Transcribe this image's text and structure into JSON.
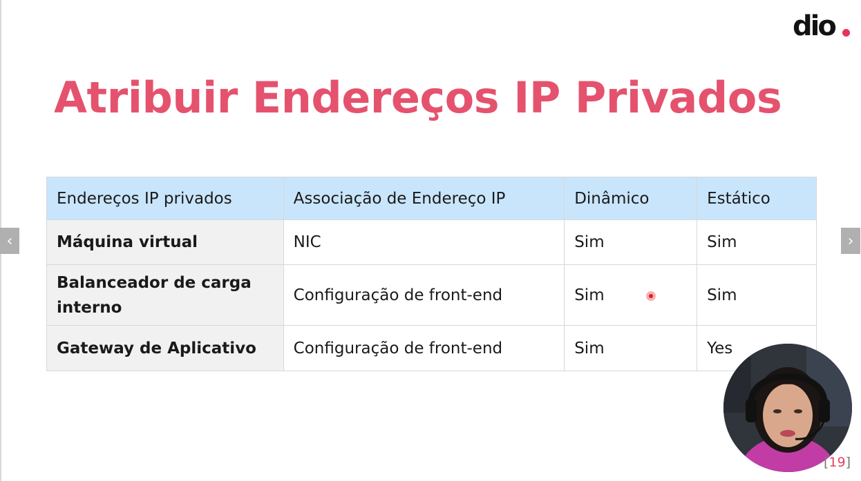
{
  "slide": {
    "logo_text": "dio",
    "title": "Atribuir Endereços IP Privados",
    "table": {
      "headers": [
        "Endereços IP privados",
        "Associação de Endereço IP",
        "Dinâmico",
        "Estático"
      ],
      "rows": [
        [
          "Máquina virtual",
          "NIC",
          "Sim",
          "Sim"
        ],
        [
          "Balanceador de carga interno",
          "Configuração de front-end",
          "Sim",
          "Sim"
        ],
        [
          "Gateway de Aplicativo",
          "Configuração de front-end",
          "Sim",
          "Yes"
        ]
      ]
    },
    "page_number": "19",
    "page_open": "[",
    "page_close": "]"
  },
  "nav": {
    "prev_icon": "chevron-left-icon",
    "prev_glyph": "‹",
    "next_icon": "chevron-right-icon",
    "next_glyph": "›"
  },
  "colors": {
    "title": "#e5526e",
    "header_bg": "#c9e5fb",
    "rowhead_bg": "#f1f1f1",
    "logo_dot": "#e8325a",
    "pointer": "#e02020"
  }
}
